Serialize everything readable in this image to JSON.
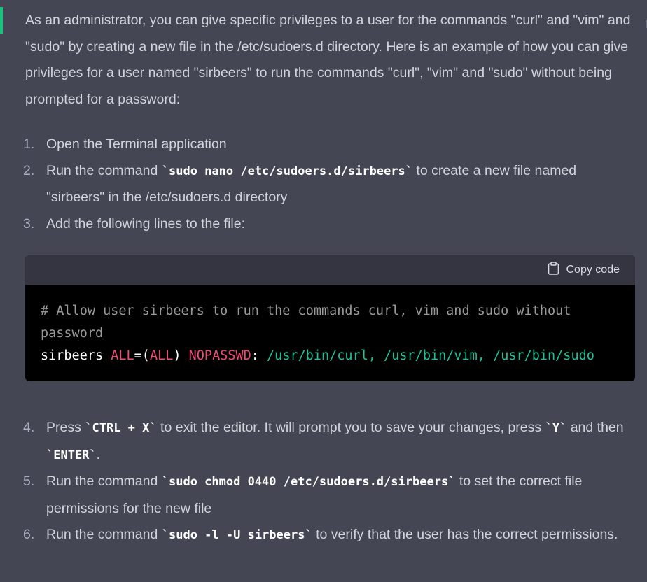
{
  "intro": "As an administrator, you can give specific privileges to a user for the commands \"curl\" and \"vim\" and \"sudo\" by creating a new file in the /etc/sudoers.d directory. Here is an example of how you can give privileges for a user named \"sirbeers\" to run the commands \"curl\", \"vim\" and \"sudo\" without being prompted for a password:",
  "steps_a": [
    {
      "num": "1.",
      "parts": [
        "Open the Terminal application"
      ]
    },
    {
      "num": "2.",
      "parts": [
        "Run the command ",
        "`sudo nano /etc/sudoers.d/sirbeers`",
        " to create a new file named \"sirbeers\" in the /etc/sudoers.d directory"
      ]
    },
    {
      "num": "3.",
      "parts": [
        "Add the following lines to the file:"
      ]
    }
  ],
  "code": {
    "copy_label": "Copy code",
    "comment": "# Allow user sirbeers to run the commands curl, vim and sudo without password",
    "user": "sirbeers",
    "all1": "ALL",
    "eq": "=(",
    "all2": "ALL",
    "close": ")",
    "nopasswd": "NOPASSWD",
    "colon": ":",
    "path1": "/usr/bin/curl,",
    "path2": "/usr/bin/vim,",
    "path3": "/usr/bin/sudo"
  },
  "steps_b": [
    {
      "num": "4.",
      "parts": [
        "Press ",
        "`CTRL + X`",
        " to exit the editor. It will prompt you to save your changes, press ",
        "`Y`",
        " and then ",
        "`ENTER`",
        "."
      ]
    },
    {
      "num": "5.",
      "parts": [
        "Run the command ",
        "`sudo chmod 0440 /etc/sudoers.d/sirbeers`",
        " to set the correct file permissions for the new file"
      ]
    },
    {
      "num": "6.",
      "parts": [
        "Run the command ",
        "`sudo -l -U sirbeers`",
        " to verify that the user has the correct permissions."
      ]
    }
  ],
  "colors": {
    "background": "#444654",
    "accent": "#19c37d",
    "keyword": "#ef4b77",
    "path": "#19c39a"
  },
  "icons": {
    "copy": "clipboard-icon"
  }
}
